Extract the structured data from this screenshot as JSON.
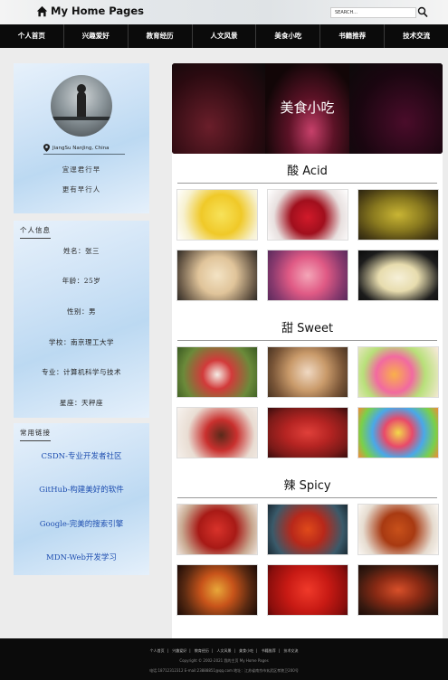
{
  "header": {
    "brand": "My Home Pages",
    "search_placeholder": "SEARCH..."
  },
  "nav": [
    "个人首页",
    "兴趣爱好",
    "教育经历",
    "人文风景",
    "美食小吃",
    "书籍推荐",
    "技术交流"
  ],
  "profile": {
    "location": "JiangSu NanJing, China",
    "motto1": "宜逞君行早",
    "motto2": "更有早行人"
  },
  "info": {
    "title": "个人信息",
    "rows": [
      "姓名：张三",
      "年龄：25岁",
      "性别：男",
      "学校：南京理工大学",
      "专业：计算机科学与技术",
      "星座：天秤座"
    ]
  },
  "links": {
    "title": "常用链接",
    "items": [
      "CSDN-专业开发者社区",
      "GitHub-构建美好的软件",
      "Google-完美的搜索引擎",
      "MDN-Web开发学习"
    ]
  },
  "banner": {
    "text": "美食小吃"
  },
  "sections": [
    {
      "title": "酸 Acid"
    },
    {
      "title": "甜 Sweet"
    },
    {
      "title": "辣 Spicy"
    }
  ],
  "footer": {
    "nav": [
      "个人首页",
      "兴趣爱好",
      "教育经历",
      "人文风景",
      "美食小吃",
      "书籍推荐",
      "技术交流"
    ],
    "copyright": "Copyright © 2002-2021 我的主页 My Home Pages",
    "address": "电话:18712312312 E-mail:23888851@qq.com 地址：江苏省南京市玄武区孝陵卫200号"
  },
  "colors": {
    "nav_bg": "#0b0b0b",
    "link": "#1f4fb0",
    "panel": "#cfe3f6"
  }
}
